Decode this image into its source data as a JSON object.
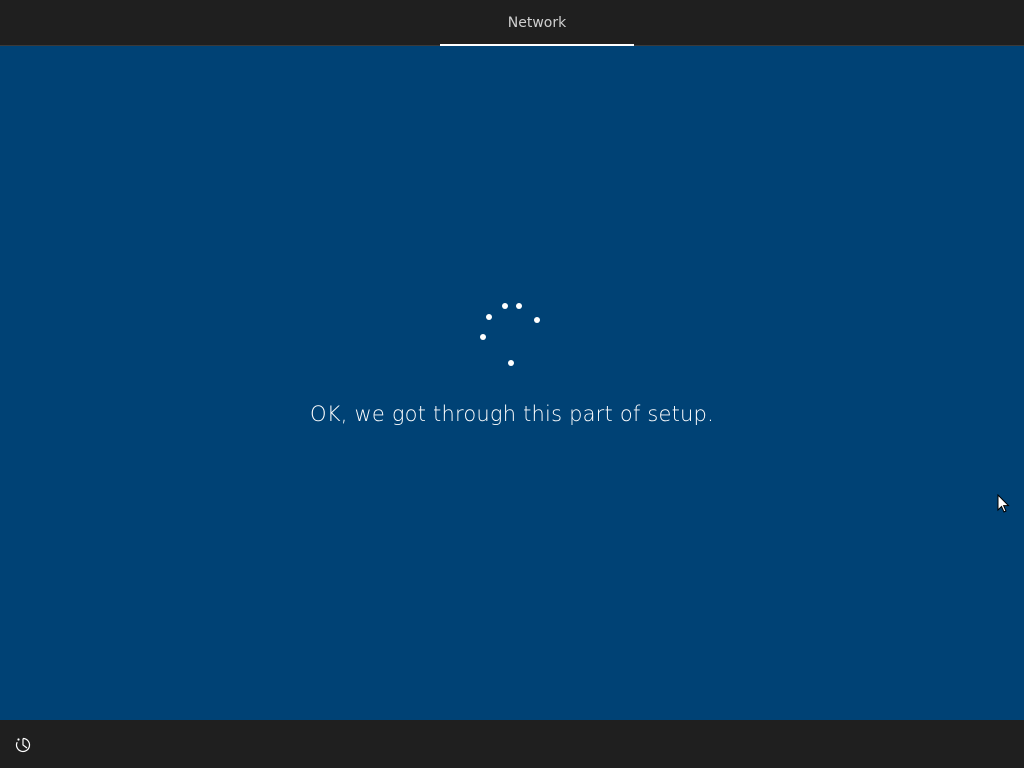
{
  "header": {
    "active_tab": "Network"
  },
  "main": {
    "message": "OK, we got through this part of setup.",
    "spinner_icon": "loading-spinner"
  },
  "footer": {
    "accessibility_icon": "ease-of-access-icon"
  },
  "colors": {
    "background": "#004275",
    "bars": "#1f1f1f",
    "text": "#ffffff"
  }
}
